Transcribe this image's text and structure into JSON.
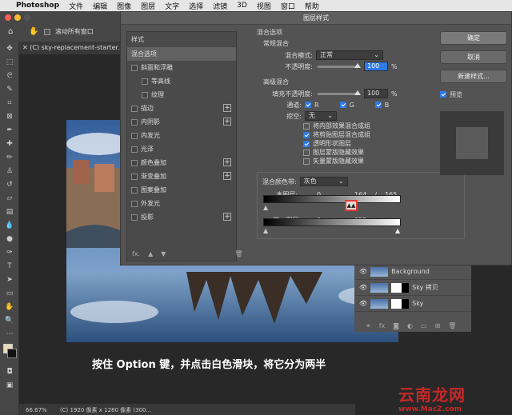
{
  "menubar": {
    "app": "Photoshop",
    "items": [
      "文件",
      "编辑",
      "图像",
      "图层",
      "文字",
      "选择",
      "滤镜",
      "3D",
      "视图",
      "窗口",
      "帮助"
    ]
  },
  "options": {
    "scroll_all": "滚动所有窗口"
  },
  "document": {
    "tab": "(C) sky-replacement-starter...",
    "status_zoom": "66.67%",
    "status_info": "(C) 1920 像素 x 1280 像素 (300..."
  },
  "caption": "按住 Option 键，并点击白色滑块，将它分为两半",
  "layers": [
    {
      "name": "Background"
    },
    {
      "name": "Sky 拷贝"
    },
    {
      "name": "Sky"
    }
  ],
  "watermark": {
    "big": "云南龙网",
    "small": "www.MacZ.com"
  },
  "dialog": {
    "title": "图层样式",
    "style_header": "样式",
    "styles": [
      {
        "label": "混合选项",
        "selected": true,
        "check": false,
        "indent": false,
        "plus": false
      },
      {
        "label": "斜面和浮雕",
        "check": true,
        "indent": false,
        "plus": false
      },
      {
        "label": "等高线",
        "check": true,
        "indent": true,
        "plus": false
      },
      {
        "label": "纹理",
        "check": true,
        "indent": true,
        "plus": false
      },
      {
        "label": "描边",
        "check": true,
        "indent": false,
        "plus": true
      },
      {
        "label": "内阴影",
        "check": true,
        "indent": false,
        "plus": true
      },
      {
        "label": "内发光",
        "check": true,
        "indent": false,
        "plus": false
      },
      {
        "label": "光泽",
        "check": true,
        "indent": false,
        "plus": false
      },
      {
        "label": "颜色叠加",
        "check": true,
        "indent": false,
        "plus": true
      },
      {
        "label": "渐变叠加",
        "check": true,
        "indent": false,
        "plus": true
      },
      {
        "label": "图案叠加",
        "check": true,
        "indent": false,
        "plus": false
      },
      {
        "label": "外发光",
        "check": true,
        "indent": false,
        "plus": false
      },
      {
        "label": "投影",
        "check": true,
        "indent": false,
        "plus": true
      }
    ],
    "footer_fx": "fx.",
    "blend_options": "混合选项",
    "general": "常规混合",
    "blend_mode_label": "混合模式:",
    "blend_mode": "正常",
    "opacity_label": "不透明度:",
    "opacity": "100",
    "pct": "%",
    "advanced": "高级混合",
    "fill_label": "填充不透明度:",
    "fill": "100",
    "channels_label": "通道:",
    "channels": [
      "R",
      "G",
      "B"
    ],
    "knockout_label": "挖空:",
    "knockout": "无",
    "adv_checks": [
      {
        "label": "将内部效果混合成组",
        "on": false
      },
      {
        "label": "将剪贴图层混合成组",
        "on": true
      },
      {
        "label": "透明形状图层",
        "on": true
      },
      {
        "label": "图层蒙版隐藏效果",
        "on": false
      },
      {
        "label": "矢量蒙版隐藏效果",
        "on": false
      }
    ],
    "blend_if_label": "混合颜色带:",
    "blend_if": "灰色",
    "this_layer_label": "本图层:",
    "this_layer_low": "0",
    "this_layer_mid": "164",
    "slash": "/",
    "this_layer_high": "165",
    "underlying_label": "下一图层:",
    "underlying_low": "0",
    "underlying_high": "255",
    "buttons": {
      "ok": "确定",
      "cancel": "取消",
      "new_style": "新建样式...",
      "preview": "预览"
    }
  }
}
